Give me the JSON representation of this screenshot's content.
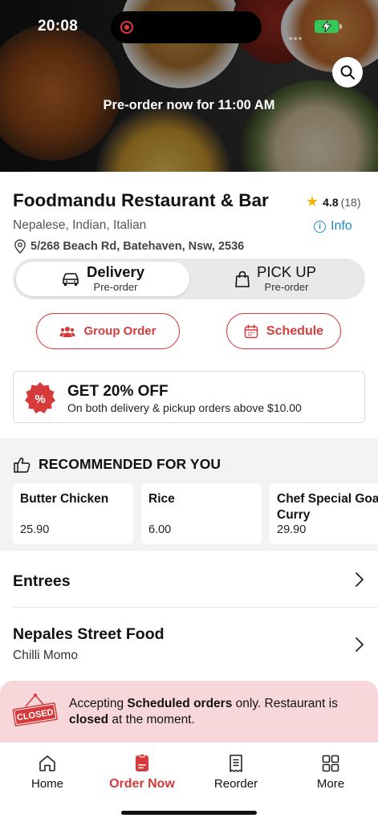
{
  "status_bar": {
    "time": "20:08"
  },
  "hero": {
    "preorder_text": "Pre-order now for 11:00 AM"
  },
  "restaurant": {
    "name": "Foodmandu Restaurant & Bar",
    "rating": "4.8",
    "rating_count": "(18)",
    "cuisines": "Nepalese, Indian, Italian",
    "info_label": "Info",
    "address": "5/268 Beach Rd, Batehaven, Nsw, 2536"
  },
  "mode_toggle": {
    "delivery_label": "Delivery",
    "delivery_sub": "Pre-order",
    "pickup_label": "PICK UP",
    "pickup_sub": "Pre-order",
    "selected": "Delivery"
  },
  "actions": {
    "group_order": "Group Order",
    "schedule": "Schedule"
  },
  "promo": {
    "title": "GET 20% OFF",
    "subtitle": "On both delivery & pickup orders above $10.00",
    "badge": "%"
  },
  "recommended": {
    "heading": "RECOMMENDED FOR YOU",
    "items": [
      {
        "name": "Butter Chicken",
        "price": "25.90"
      },
      {
        "name": "Rice",
        "price": "6.00"
      },
      {
        "name_line1": "Chef Special Goat",
        "name_line2": "Curry",
        "price": "29.90"
      }
    ]
  },
  "menu_sections": [
    {
      "title": "Entrees"
    },
    {
      "title": "Nepales Street Food",
      "subtitle": "Chilli Momo"
    }
  ],
  "closed_notice": {
    "sign": "CLOSED",
    "part1": "Accepting ",
    "bold1": "Scheduled orders",
    "part2": " only. Restaurant is ",
    "bold2": "closed",
    "part3": " at the moment."
  },
  "tab_bar": {
    "home": "Home",
    "order_now": "Order Now",
    "reorder": "Reorder",
    "more": "More",
    "active": "Order Now"
  },
  "colors": {
    "accent": "#d63a3a",
    "link": "#1e88c8",
    "star": "#f5b400",
    "closed_bg": "#f8d7da",
    "battery": "#35c759"
  },
  "icons": [
    "search-icon",
    "info-icon",
    "location-pin-icon",
    "car-icon",
    "shopping-bag-icon",
    "group-icon",
    "calendar-icon",
    "discount-badge-icon",
    "thumbs-up-icon",
    "chevron-right-icon",
    "closed-sign-icon",
    "home-icon",
    "order-icon",
    "receipt-icon",
    "grid-icon",
    "star-icon"
  ]
}
